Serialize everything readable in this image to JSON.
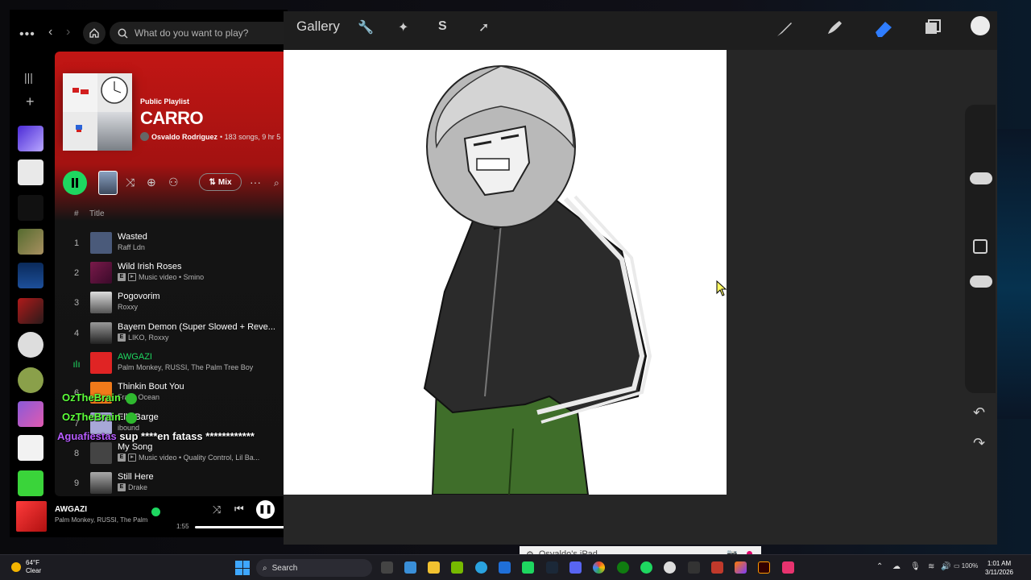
{
  "spotify": {
    "search_placeholder": "What do you want to play?",
    "playlist": {
      "type": "Public Playlist",
      "title": "CARRO",
      "owner": "Osvaldo Rodriguez",
      "meta": "• 183 songs, 9 hr 5"
    },
    "controls": {
      "mix_label": "Mix"
    },
    "table_header": {
      "hash": "#",
      "title": "Title"
    },
    "tracks": [
      {
        "num": "1",
        "title": "Wasted",
        "artist": "Raff Ldn",
        "explicit": false,
        "video": false,
        "color": "#4a5a7a"
      },
      {
        "num": "2",
        "title": "Wild Irish Roses",
        "artist": "Music video • Smino",
        "explicit": true,
        "video": true,
        "color": "#7a1a4a"
      },
      {
        "num": "3",
        "title": "Pogovorim",
        "artist": "Roxxy",
        "explicit": false,
        "video": false,
        "color": "#555555"
      },
      {
        "num": "4",
        "title": "Bayern Demon (Super Slowed + Reve...",
        "artist": "LIKO, Roxxy",
        "explicit": true,
        "video": false,
        "color": "#333333"
      },
      {
        "num": "5",
        "title": "AWGAZI",
        "artist": "Palm Monkey, RUSSI, The Palm Tree Boy",
        "explicit": false,
        "video": false,
        "playing": true,
        "color": "#e02424"
      },
      {
        "num": "6",
        "title": "Thinkin Bout You",
        "artist": "Frank Ocean",
        "explicit": false,
        "video": false,
        "color": "#f07a1a"
      },
      {
        "num": "7",
        "title": "Elle Barge",
        "artist": "ibound",
        "explicit": false,
        "video": false,
        "color": "#a8a8d8"
      },
      {
        "num": "8",
        "title": "My Song",
        "artist": "Music video • Quality Control, Lil Ba...",
        "explicit": true,
        "video": true,
        "color": "#444444"
      },
      {
        "num": "9",
        "title": "Still Here",
        "artist": "Drake",
        "explicit": true,
        "video": false,
        "color": "#666666"
      }
    ],
    "now_playing": {
      "title": "AWGAZI",
      "artist": "Palm Monkey, RUSSI, The Palm",
      "elapsed": "1:55"
    }
  },
  "chat": [
    {
      "user": "OzTheBrain",
      "message": ""
    },
    {
      "user": "OzTheBrain",
      "message": ""
    },
    {
      "user": "Aguafiestas",
      "message": "sup ****en fatass ************"
    }
  ],
  "procreate": {
    "gallery_label": "Gallery"
  },
  "ipad_bar": {
    "label": "Osvaldo's iPad"
  },
  "taskbar": {
    "weather_temp": "64°F",
    "weather_desc": "Clear",
    "search_label": "Search",
    "battery": "100%",
    "time": "1:01 AM",
    "date": "3/11/2026"
  },
  "colors": {
    "spotify_green": "#1ed760",
    "playlist_red": "#c21614",
    "chat_green": "#5dff3b",
    "chat_purple": "#b75cff",
    "procreate_bg": "#262626",
    "eraser_blue": "#2f7dff"
  }
}
